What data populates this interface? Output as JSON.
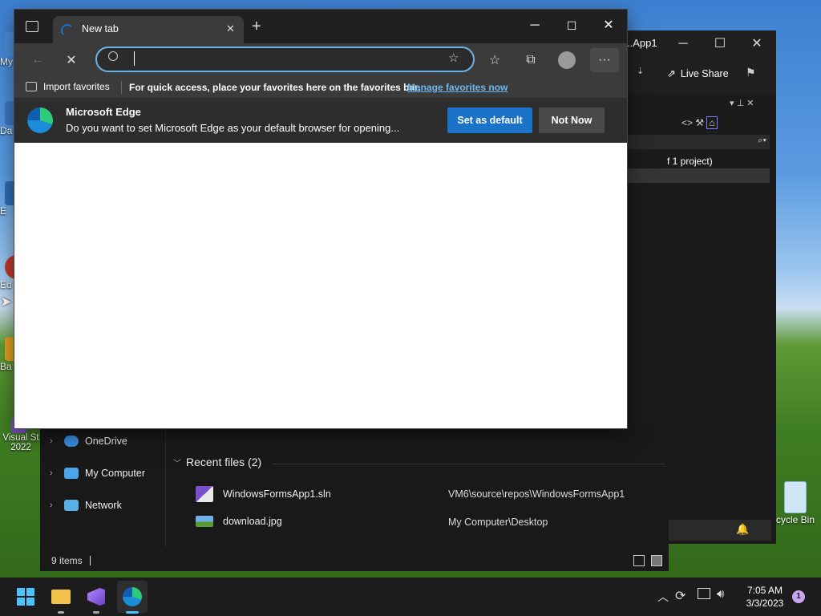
{
  "desktop": {
    "icons": [
      {
        "label": "My",
        "color": "#4a90d9"
      },
      {
        "label": "Da",
        "color": "#3b78c2"
      },
      {
        "label": "E",
        "color": "#2e6db4"
      },
      {
        "label": "Ed",
        "color": "#c0392b"
      },
      {
        "label": "Ba",
        "color": "#e0a020"
      },
      {
        "label": "Visual St 2022",
        "color": "#7b4fc9"
      }
    ],
    "recycle_bin_label": "cycle Bin"
  },
  "vs_window": {
    "title": "..App1",
    "live_share": "Live Share",
    "solution_text": "f 1 project)",
    "minimize": "─",
    "maximize": "☐",
    "close": "✕"
  },
  "explorer": {
    "nav": [
      {
        "label": "OneDrive",
        "icon": "cloud-icon"
      },
      {
        "label": "My Computer",
        "icon": "computer-icon"
      },
      {
        "label": "Network",
        "icon": "network-icon"
      }
    ],
    "recent_header": "Recent files (2)",
    "recent_files": [
      {
        "name": "WindowsFormsApp1.sln",
        "path": "VM6\\source\\repos\\WindowsFormsApp1"
      },
      {
        "name": "download.jpg",
        "path": "My Computer\\Desktop"
      }
    ],
    "status": "9 items"
  },
  "edge": {
    "tab_title": "New tab",
    "address_value": "",
    "favbar": {
      "import": "Import favorites",
      "hint": "For quick access, place your favorites here on the favorites bar.",
      "manage_link": "Manage favorites now"
    },
    "banner": {
      "title": "Microsoft Edge",
      "message": "Do you want to set Microsoft Edge as your default browser for opening...",
      "set_default": "Set as default",
      "not_now": "Not Now"
    },
    "colors": {
      "accent": "#1a73c7",
      "link": "#6cb8f5"
    }
  },
  "taskbar": {
    "time": "7:05 AM",
    "date": "3/3/2023",
    "notifications": "1"
  }
}
